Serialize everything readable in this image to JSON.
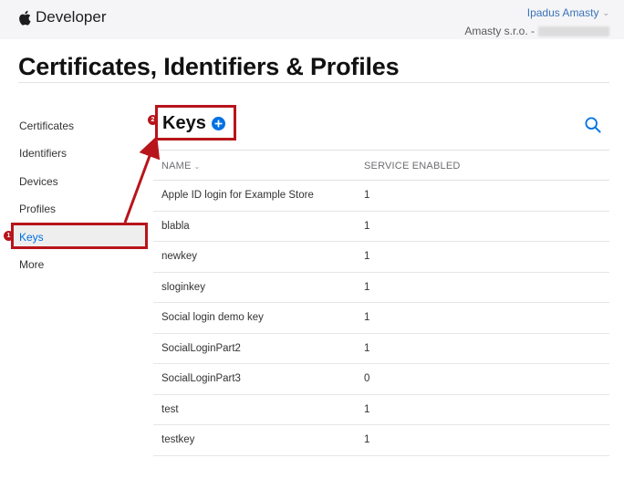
{
  "header": {
    "brand": "Developer",
    "account_name": "Ipadus Amasty",
    "account_org": "Amasty s.r.o. -"
  },
  "page_title": "Certificates, Identifiers & Profiles",
  "sidebar": {
    "items": [
      {
        "label": "Certificates"
      },
      {
        "label": "Identifiers"
      },
      {
        "label": "Devices"
      },
      {
        "label": "Profiles"
      },
      {
        "label": "Keys"
      },
      {
        "label": "More"
      }
    ],
    "selected": "Keys"
  },
  "section": {
    "title": "Keys"
  },
  "table": {
    "columns": [
      "NAME",
      "SERVICE ENABLED"
    ],
    "rows": [
      {
        "name": "Apple ID login for Example Store",
        "services": "1"
      },
      {
        "name": "blabla",
        "services": "1"
      },
      {
        "name": "newkey",
        "services": "1"
      },
      {
        "name": "sloginkey",
        "services": "1"
      },
      {
        "name": "Social login demo key",
        "services": "1"
      },
      {
        "name": "SocialLoginPart2",
        "services": "1"
      },
      {
        "name": "SocialLoginPart3",
        "services": "0"
      },
      {
        "name": "test",
        "services": "1"
      },
      {
        "name": "testkey",
        "services": "1"
      }
    ]
  },
  "annotations": {
    "step1": "1",
    "step2": "2"
  },
  "colors": {
    "accent": "#0071e3",
    "link": "#3a73b8",
    "annotation": "#b8141b",
    "topbar": "#f5f5f7"
  },
  "icons": [
    "apple-logo-icon",
    "chevron-down-icon",
    "add-circle-icon",
    "search-icon",
    "sort-down-icon"
  ]
}
